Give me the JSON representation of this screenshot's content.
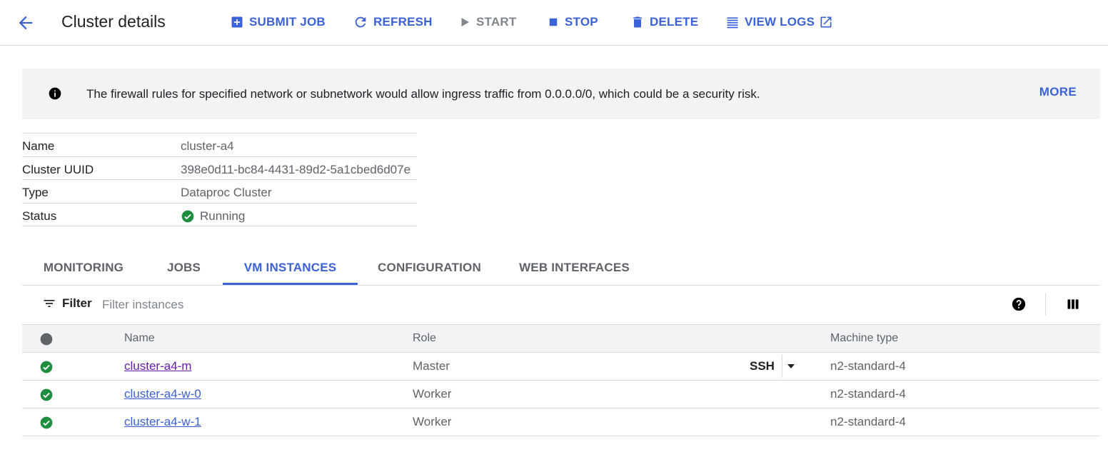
{
  "header": {
    "title": "Cluster details",
    "actions": [
      {
        "label": "SUBMIT JOB",
        "icon": "add-box-icon",
        "enabled": true
      },
      {
        "label": "REFRESH",
        "icon": "refresh-icon",
        "enabled": true
      },
      {
        "label": "START",
        "icon": "play-icon",
        "enabled": false
      },
      {
        "label": "STOP",
        "icon": "stop-icon",
        "enabled": true
      },
      {
        "label": "DELETE",
        "icon": "trash-icon",
        "enabled": true
      },
      {
        "label": "VIEW LOGS",
        "icon": "list-icon",
        "trailing_icon": "open-in-new-icon",
        "enabled": true
      }
    ]
  },
  "banner": {
    "icon": "info-icon",
    "text": "The firewall rules for specified network or subnetwork would allow ingress traffic from 0.0.0.0/0, which could be a security risk.",
    "more_label": "MORE"
  },
  "details": [
    {
      "key": "Name",
      "value": "cluster-a4"
    },
    {
      "key": "Cluster UUID",
      "value": "398e0d11-bc84-4431-89d2-5a1cbed6d07e"
    },
    {
      "key": "Type",
      "value": "Dataproc Cluster"
    },
    {
      "key": "Status",
      "value": "Running",
      "icon": "check-circle-icon"
    }
  ],
  "tabs": [
    {
      "label": "MONITORING",
      "active": false
    },
    {
      "label": "JOBS",
      "active": false
    },
    {
      "label": "VM INSTANCES",
      "active": true
    },
    {
      "label": "CONFIGURATION",
      "active": false
    },
    {
      "label": "WEB INTERFACES",
      "active": false
    }
  ],
  "filter": {
    "label": "Filter",
    "placeholder": "Filter instances"
  },
  "table": {
    "columns": [
      "Name",
      "Role",
      "Machine type"
    ],
    "rows": [
      {
        "name": "cluster-a4-m",
        "role": "Master",
        "machine_type": "n2-standard-4",
        "ssh_label": "SSH",
        "visited": true
      },
      {
        "name": "cluster-a4-w-0",
        "role": "Worker",
        "machine_type": "n2-standard-4",
        "visited": false
      },
      {
        "name": "cluster-a4-w-1",
        "role": "Worker",
        "machine_type": "n2-standard-4",
        "visited": false
      }
    ]
  },
  "colors": {
    "accent": "#3b62d6",
    "success": "#1e8e3e",
    "visited_link": "#681da8"
  }
}
